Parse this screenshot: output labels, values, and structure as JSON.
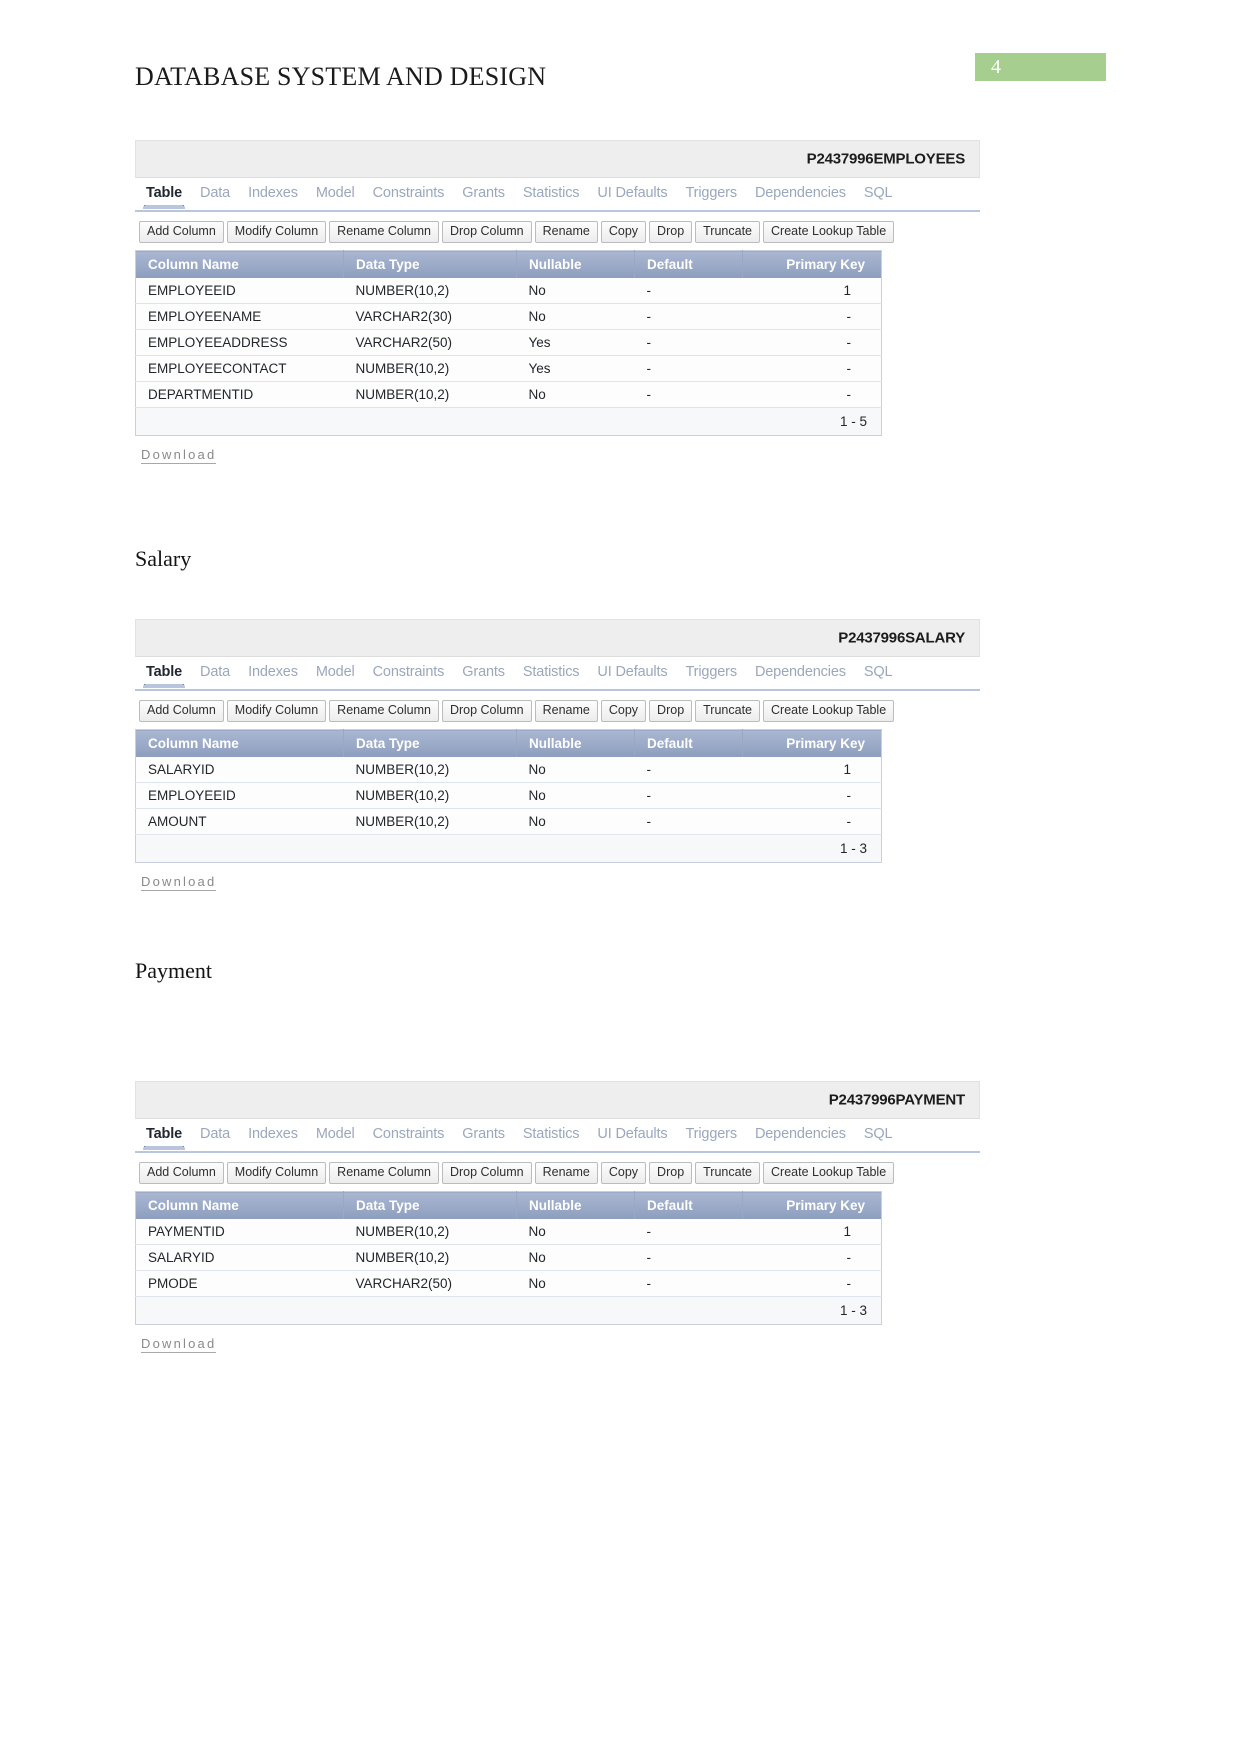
{
  "document": {
    "header_title": "DATABASE SYSTEM AND DESIGN",
    "page_number": "4",
    "badge_color": "#a6cf8f"
  },
  "captions": {
    "salary": "Salary",
    "payment": "Payment"
  },
  "tabs": [
    {
      "label": "Table",
      "active": true
    },
    {
      "label": "Data",
      "active": false
    },
    {
      "label": "Indexes",
      "active": false
    },
    {
      "label": "Model",
      "active": false
    },
    {
      "label": "Constraints",
      "active": false
    },
    {
      "label": "Grants",
      "active": false
    },
    {
      "label": "Statistics",
      "active": false
    },
    {
      "label": "UI Defaults",
      "active": false
    },
    {
      "label": "Triggers",
      "active": false
    },
    {
      "label": "Dependencies",
      "active": false
    },
    {
      "label": "SQL",
      "active": false
    }
  ],
  "buttons": [
    "Add Column",
    "Modify Column",
    "Rename Column",
    "Drop Column",
    "Rename",
    "Copy",
    "Drop",
    "Truncate",
    "Create Lookup Table"
  ],
  "table_columns": [
    "Column Name",
    "Data Type",
    "Nullable",
    "Default",
    "Primary Key"
  ],
  "download_label": "Download",
  "panels": [
    {
      "id": "employees",
      "title": "P2437996EMPLOYEES",
      "rows": [
        {
          "name": "EMPLOYEEID",
          "type": "NUMBER(10,2)",
          "nullable": "No",
          "default": "-",
          "pk": "1"
        },
        {
          "name": "EMPLOYEENAME",
          "type": "VARCHAR2(30)",
          "nullable": "No",
          "default": "-",
          "pk": "-"
        },
        {
          "name": "EMPLOYEEADDRESS",
          "type": "VARCHAR2(50)",
          "nullable": "Yes",
          "default": "-",
          "pk": "-"
        },
        {
          "name": "EMPLOYEECONTACT",
          "type": "NUMBER(10,2)",
          "nullable": "Yes",
          "default": "-",
          "pk": "-"
        },
        {
          "name": "DEPARTMENTID",
          "type": "NUMBER(10,2)",
          "nullable": "No",
          "default": "-",
          "pk": "-"
        }
      ],
      "range": "1 - 5"
    },
    {
      "id": "salary",
      "title": "P2437996SALARY",
      "rows": [
        {
          "name": "SALARYID",
          "type": "NUMBER(10,2)",
          "nullable": "No",
          "default": "-",
          "pk": "1"
        },
        {
          "name": "EMPLOYEEID",
          "type": "NUMBER(10,2)",
          "nullable": "No",
          "default": "-",
          "pk": "-"
        },
        {
          "name": "AMOUNT",
          "type": "NUMBER(10,2)",
          "nullable": "No",
          "default": "-",
          "pk": "-"
        }
      ],
      "range": "1 - 3"
    },
    {
      "id": "payment",
      "title": "P2437996PAYMENT",
      "rows": [
        {
          "name": "PAYMENTID",
          "type": "NUMBER(10,2)",
          "nullable": "No",
          "default": "-",
          "pk": "1"
        },
        {
          "name": "SALARYID",
          "type": "NUMBER(10,2)",
          "nullable": "No",
          "default": "-",
          "pk": "-"
        },
        {
          "name": "PMODE",
          "type": "VARCHAR2(50)",
          "nullable": "No",
          "default": "-",
          "pk": "-"
        }
      ],
      "range": "1 - 3"
    }
  ]
}
